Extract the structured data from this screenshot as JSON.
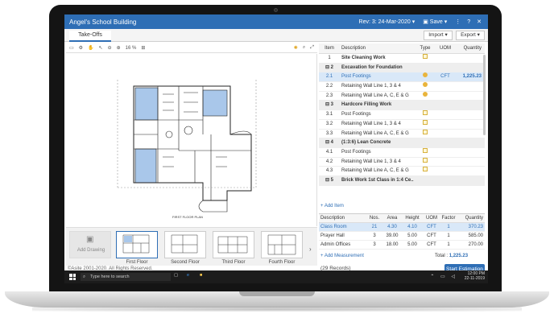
{
  "window": {
    "title": "Angel's School Building",
    "revision": "Rev: 3: 24-Mar-2020",
    "save_label": "Save"
  },
  "tabs": [
    {
      "label": "Take-Offs"
    }
  ],
  "toolbar": {
    "import_label": "Import",
    "export_label": "Export",
    "zoom": "16 %"
  },
  "drawing": {
    "caption": "FIRST FLOOR PLAN"
  },
  "thumbnails": {
    "add_label": "Add Drawing",
    "items": [
      {
        "label": "First Floor"
      },
      {
        "label": "Second Floor"
      },
      {
        "label": "Third Floor"
      },
      {
        "label": "Fourth Floor"
      }
    ]
  },
  "footer": {
    "copyright": "©Asite 2001-2020. All Rights Reserved."
  },
  "items_table": {
    "headers": {
      "item": "Item",
      "description": "Description",
      "type": "Type",
      "uom": "UOM",
      "quantity": "Quantity"
    },
    "rows": [
      {
        "item": "1",
        "description": "Site Cleaning Work",
        "type": "check",
        "uom": "",
        "quantity": "",
        "group": false,
        "bold": true
      },
      {
        "item": "2",
        "description": "Excavation for Foundation",
        "type": "",
        "uom": "",
        "quantity": "",
        "group": true
      },
      {
        "item": "2.1",
        "description": "Post Footings",
        "type": "dot",
        "uom": "CFT",
        "quantity": "1,225.23",
        "group": false,
        "selected": true
      },
      {
        "item": "2.2",
        "description": "Retaining Wall Line 1, 3 & 4",
        "type": "dot",
        "uom": "",
        "quantity": "",
        "group": false
      },
      {
        "item": "2.3",
        "description": "Retaining Wall Line A, C, E & G",
        "type": "dot",
        "uom": "",
        "quantity": "",
        "group": false
      },
      {
        "item": "3",
        "description": "Hardcore Filling Work",
        "type": "",
        "uom": "",
        "quantity": "",
        "group": true
      },
      {
        "item": "3.1",
        "description": "Post Footings",
        "type": "check",
        "uom": "",
        "quantity": "",
        "group": false
      },
      {
        "item": "3.2",
        "description": "Retaining Wall Line 1, 3 & 4",
        "type": "check",
        "uom": "",
        "quantity": "",
        "group": false
      },
      {
        "item": "3.3",
        "description": "Retaining Wall Line A, C, E & G",
        "type": "check",
        "uom": "",
        "quantity": "",
        "group": false
      },
      {
        "item": "4",
        "description": "(1:3:6) Lean Concrete",
        "type": "",
        "uom": "",
        "quantity": "",
        "group": true
      },
      {
        "item": "4.1",
        "description": "Post Footings",
        "type": "check",
        "uom": "",
        "quantity": "",
        "group": false
      },
      {
        "item": "4.2",
        "description": "Retaining Wall Line 1, 3 & 4",
        "type": "check",
        "uom": "",
        "quantity": "",
        "group": false
      },
      {
        "item": "4.3",
        "description": "Retaining Wall Line A, C, E & G",
        "type": "check",
        "uom": "",
        "quantity": "",
        "group": false
      },
      {
        "item": "5",
        "description": "Brick Work 1st Class in 1:4 Ce..",
        "type": "",
        "uom": "",
        "quantity": "",
        "group": true
      }
    ],
    "add_item_label": "+ Add Item"
  },
  "measurements": {
    "headers": {
      "description": "Description",
      "nos": "Nos.",
      "area": "Area",
      "height": "Height",
      "uom": "UOM",
      "factor": "Factor",
      "quantity": "Quantity"
    },
    "rows": [
      {
        "description": "Class Room",
        "nos": "21",
        "area": "4.30",
        "height": "4.10",
        "uom": "CFT",
        "factor": "1",
        "quantity": "370.23",
        "selected": true
      },
      {
        "description": "Prayer Hall",
        "nos": "3",
        "area": "39.00",
        "height": "5.00",
        "uom": "CFT",
        "factor": "1",
        "quantity": "585.00"
      },
      {
        "description": "Admin Offices",
        "nos": "3",
        "area": "18.00",
        "height": "5.00",
        "uom": "CFT",
        "factor": "1",
        "quantity": "270.00"
      }
    ],
    "add_label": "+ Add Measurement",
    "total_label": "Total :",
    "total_value": "1,225.23"
  },
  "status": {
    "records": "(29 Records)",
    "start_label": "Start Estimation"
  },
  "taskbar": {
    "search_placeholder": "Type here to search",
    "time": "12:00 PM",
    "date": "22-11-2019"
  }
}
